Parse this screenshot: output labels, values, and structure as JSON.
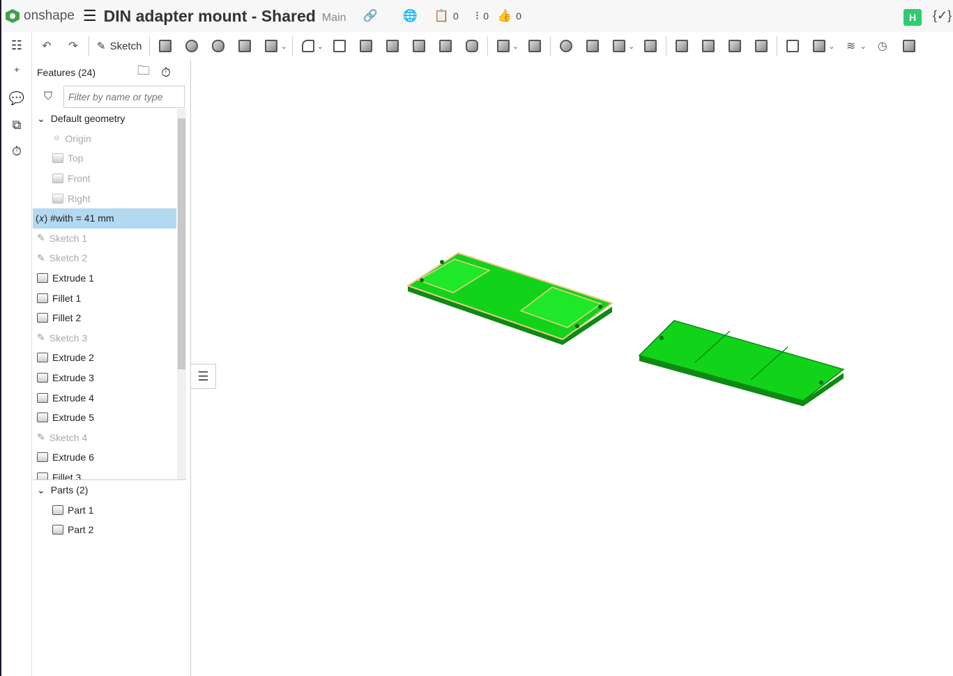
{
  "app": {
    "brand": "onshape",
    "title": "DIN adapter mount - Shared",
    "branch": "Main",
    "versions_count": "0",
    "branches_count": "0",
    "likes_count": "0",
    "user_initial": "H",
    "code_label": "{✓}",
    "brand_color": "#3fa34d",
    "selection_color": "#b3d9f2",
    "part_color": "#11d41a"
  },
  "toolbar": {
    "sketch_label": "Sketch"
  },
  "features": {
    "header": "Features (24)",
    "filter_placeholder": "Filter by name or type",
    "items": [
      {
        "label": "Default geometry",
        "type": "group"
      },
      {
        "label": "Origin",
        "type": "origin"
      },
      {
        "label": "Top",
        "type": "plane"
      },
      {
        "label": "Front",
        "type": "plane"
      },
      {
        "label": "Right",
        "type": "plane"
      },
      {
        "label": "#with = 41 mm",
        "type": "variable",
        "selected": true
      },
      {
        "label": "Sketch 1",
        "type": "sketch"
      },
      {
        "label": "Sketch 2",
        "type": "sketch"
      },
      {
        "label": "Extrude 1",
        "type": "feature"
      },
      {
        "label": "Fillet 1",
        "type": "feature"
      },
      {
        "label": "Fillet 2",
        "type": "feature"
      },
      {
        "label": "Sketch 3",
        "type": "sketch"
      },
      {
        "label": "Extrude 2",
        "type": "feature"
      },
      {
        "label": "Extrude 3",
        "type": "feature"
      },
      {
        "label": "Extrude 4",
        "type": "feature"
      },
      {
        "label": "Extrude 5",
        "type": "feature"
      },
      {
        "label": "Sketch 4",
        "type": "sketch"
      },
      {
        "label": "Extrude 6",
        "type": "feature"
      },
      {
        "label": "Fillet 3",
        "type": "feature"
      }
    ]
  },
  "parts": {
    "header": "Parts (2)",
    "items": [
      "Part 1",
      "Part 2"
    ]
  }
}
